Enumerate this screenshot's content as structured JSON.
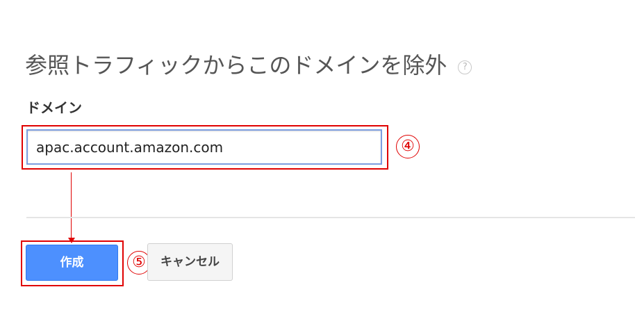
{
  "dialog": {
    "title": "参照トラフィックからこのドメインを除外",
    "help_icon_glyph": "?"
  },
  "form": {
    "domain_label": "ドメイン",
    "domain_value": "apac.account.amazon.com"
  },
  "buttons": {
    "create_label": "作成",
    "cancel_label": "キャンセル"
  },
  "annotations": {
    "step_4": "④",
    "step_5": "⑤",
    "highlight_color": "#e00000"
  },
  "colors": {
    "primary_button": "#4d90fe",
    "input_focus_border": "#7c9ee0"
  }
}
